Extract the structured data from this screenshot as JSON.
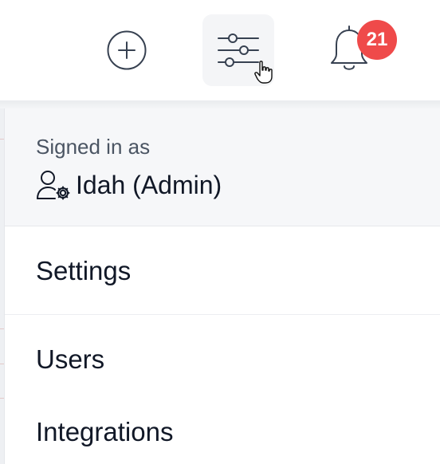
{
  "notifications": {
    "count": "21"
  },
  "menu": {
    "signed_in_label": "Signed in as",
    "user_name": "Idah (Admin)",
    "items": [
      {
        "label": "Settings"
      },
      {
        "label": "Users"
      },
      {
        "label": "Integrations"
      }
    ]
  },
  "colors": {
    "badge": "#ef4a4a",
    "header_bg": "#f6f7f9",
    "text": "#111827",
    "muted_text": "#4b5563"
  },
  "icons": [
    "plus-circle-icon",
    "sliders-icon",
    "bell-icon",
    "hand-pointer-cursor",
    "user-cog-icon"
  ]
}
